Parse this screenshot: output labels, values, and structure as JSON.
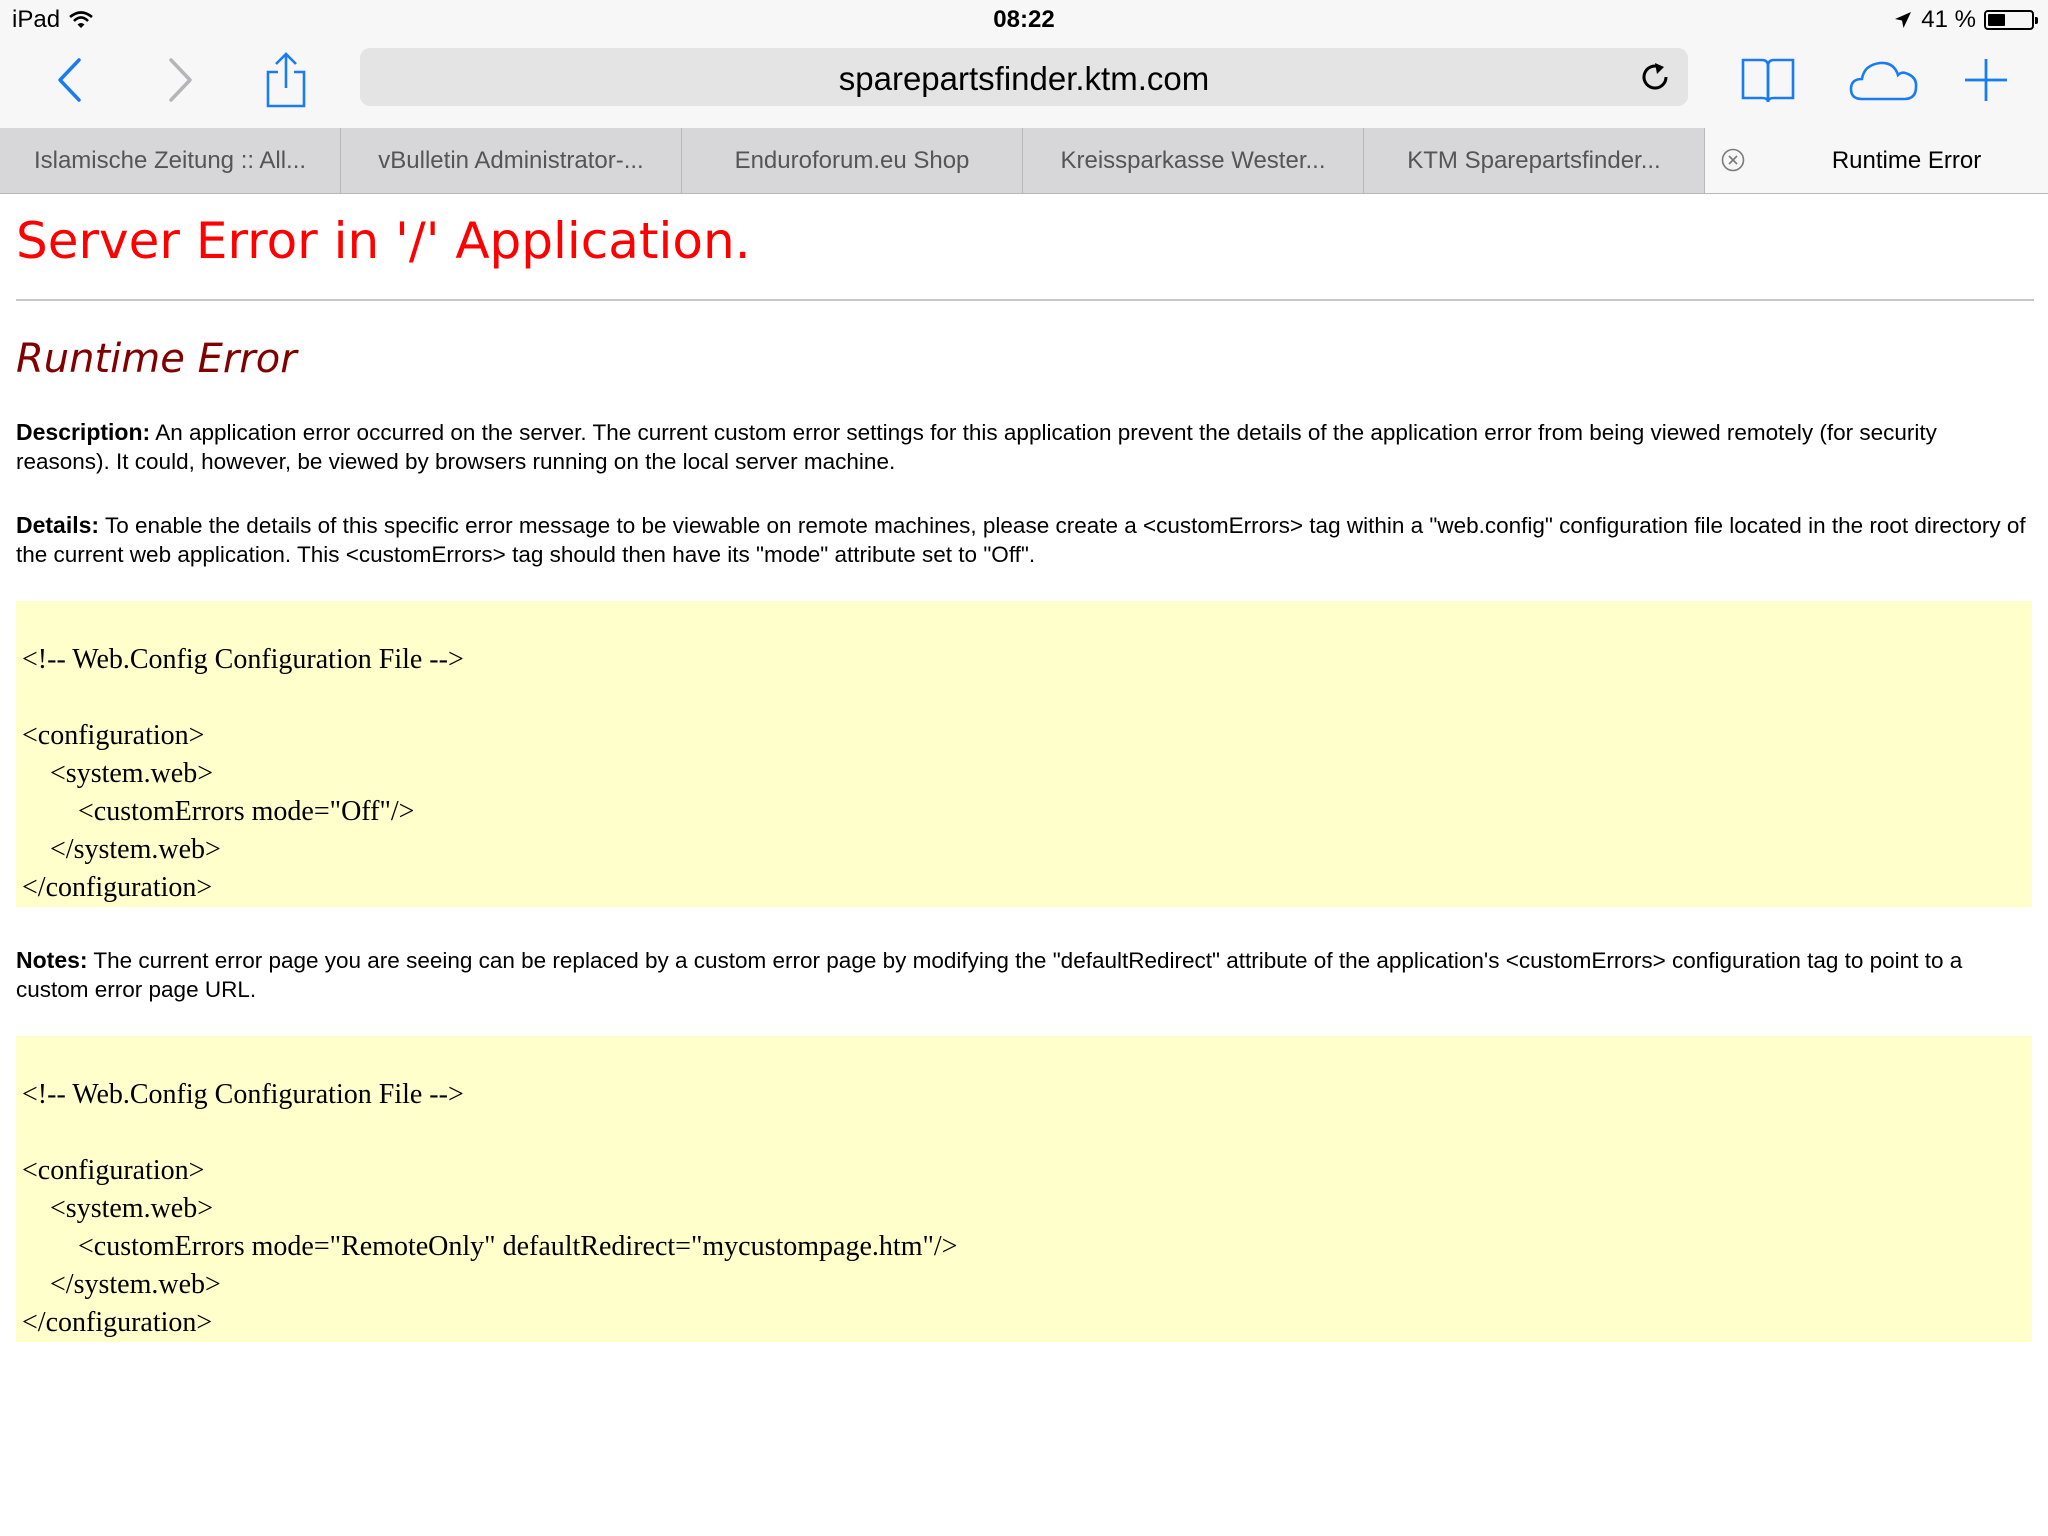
{
  "status_bar": {
    "device": "iPad",
    "time": "08:22",
    "battery": "41 %",
    "battery_level": 0.41,
    "icons": [
      "wifi-icon",
      "location-arrow-icon",
      "battery-icon"
    ]
  },
  "toolbar": {
    "url": "sparepartsfinder.ktm.com",
    "icons": [
      "back-icon",
      "forward-icon",
      "share-icon",
      "reload-icon",
      "bookmarks-icon",
      "cloud-tabs-icon",
      "new-tab-icon"
    ],
    "accent_color": "#1a7cf5"
  },
  "tabs": [
    {
      "label": "Islamische Zeitung :: All...",
      "active": false
    },
    {
      "label": "vBulletin Administrator-...",
      "active": false
    },
    {
      "label": "Enduroforum.eu Shop",
      "active": false
    },
    {
      "label": "Kreissparkasse Wester...",
      "active": false
    },
    {
      "label": "KTM Sparepartsfinder...",
      "active": false
    },
    {
      "label": "Runtime Error",
      "active": true
    }
  ],
  "page": {
    "heading": "Server Error in '/' Application.",
    "subheading": "Runtime Error",
    "description_label": "Description:",
    "description_text": " An application error occurred on the server. The current custom error settings for this application prevent the details of the application error from being viewed remotely (for security reasons). It could, however, be viewed by browsers running on the local server machine.",
    "details_label": "Details:",
    "details_text": " To enable the details of this specific error message to be viewable on remote machines, please create a <customErrors> tag within a \"web.config\" configuration file located in the root directory of the current web application. This <customErrors> tag should then have its \"mode\" attribute set to \"Off\".",
    "code1": [
      "",
      "<!-- Web.Config Configuration File -->",
      "",
      "<configuration>",
      "    <system.web>",
      "        <customErrors mode=\"Off\"/>",
      "    </system.web>",
      "</configuration>"
    ],
    "notes_label": "Notes:",
    "notes_text": " The current error page you are seeing can be replaced by a custom error page by modifying the \"defaultRedirect\" attribute of the application's <customErrors> configuration tag to point to a custom error page URL.",
    "code2": [
      "",
      "<!-- Web.Config Configuration File -->",
      "",
      "<configuration>",
      "    <system.web>",
      "        <customErrors mode=\"RemoteOnly\" defaultRedirect=\"mycustompage.htm\"/>",
      "    </system.web>",
      "</configuration>"
    ],
    "colors": {
      "heading": "#ff0000",
      "subheading": "#800000",
      "code_background": "#ffffcc"
    }
  }
}
